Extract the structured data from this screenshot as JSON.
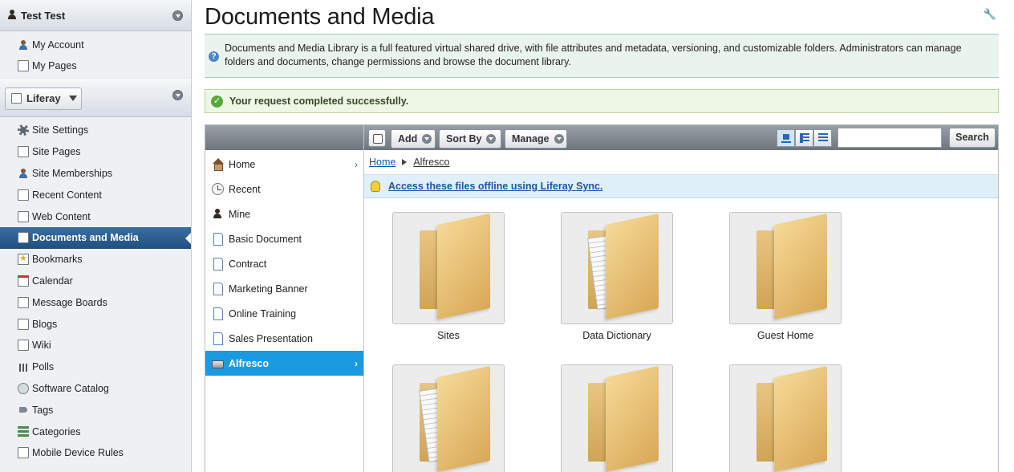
{
  "user": {
    "name": "Test Test"
  },
  "user_menu": [
    {
      "label": "My Account",
      "icon": "account-icon"
    },
    {
      "label": "My Pages",
      "icon": "pages-icon"
    }
  ],
  "site": {
    "name": "Liferay"
  },
  "site_menu": [
    {
      "label": "Site Settings",
      "icon": "gear-icon"
    },
    {
      "label": "Site Pages",
      "icon": "pages-icon"
    },
    {
      "label": "Site Memberships",
      "icon": "members-icon"
    },
    {
      "label": "Recent Content",
      "icon": "recent-icon"
    },
    {
      "label": "Web Content",
      "icon": "web-content-icon"
    },
    {
      "label": "Documents and Media",
      "icon": "documents-icon",
      "active": true
    },
    {
      "label": "Bookmarks",
      "icon": "bookmark-icon"
    },
    {
      "label": "Calendar",
      "icon": "calendar-icon"
    },
    {
      "label": "Message Boards",
      "icon": "message-icon"
    },
    {
      "label": "Blogs",
      "icon": "blog-icon"
    },
    {
      "label": "Wiki",
      "icon": "wiki-icon"
    },
    {
      "label": "Polls",
      "icon": "poll-icon"
    },
    {
      "label": "Software Catalog",
      "icon": "catalog-icon"
    },
    {
      "label": "Tags",
      "icon": "tag-icon"
    },
    {
      "label": "Categories",
      "icon": "categories-icon"
    },
    {
      "label": "Mobile Device Rules",
      "icon": "mobile-icon"
    }
  ],
  "page": {
    "title": "Documents and Media",
    "info": "Documents and Media Library is a full featured virtual shared drive, with file attributes and metadata, versioning, and customizable folders. Administrators can manage folders and documents, change permissions and browse the document library.",
    "success": "Your request completed successfully."
  },
  "nav": [
    {
      "label": "Home",
      "icon": "home-icon",
      "chevron": true
    },
    {
      "label": "Recent",
      "icon": "clock-icon"
    },
    {
      "label": "Mine",
      "icon": "user-icon"
    },
    {
      "label": "Basic Document",
      "icon": "document-icon"
    },
    {
      "label": "Contract",
      "icon": "document-icon"
    },
    {
      "label": "Marketing Banner",
      "icon": "document-icon"
    },
    {
      "label": "Online Training",
      "icon": "document-icon"
    },
    {
      "label": "Sales Presentation",
      "icon": "document-icon"
    },
    {
      "label": "Alfresco",
      "icon": "drive-icon",
      "chevron": true,
      "selected": true
    }
  ],
  "toolbar": {
    "add": "Add",
    "sort_by": "Sort By",
    "manage": "Manage",
    "search_value": "",
    "search_button": "Search"
  },
  "breadcrumb": {
    "home": "Home",
    "current": "Alfresco"
  },
  "sync_link": "Access these files offline using Liferay Sync.",
  "folders": [
    {
      "label": "Sites",
      "has_papers": false
    },
    {
      "label": "Data Dictionary",
      "has_papers": true
    },
    {
      "label": "Guest Home",
      "has_papers": false
    },
    {
      "label": "",
      "has_papers": true
    },
    {
      "label": "",
      "has_papers": false
    },
    {
      "label": "",
      "has_papers": false
    }
  ]
}
